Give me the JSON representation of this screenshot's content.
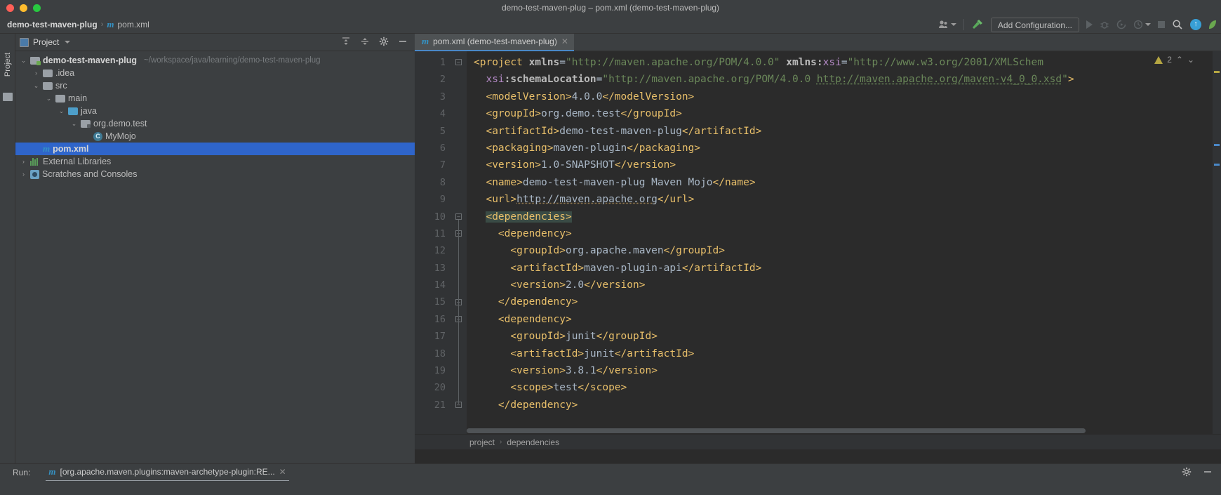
{
  "window": {
    "title": "demo-test-maven-plug – pom.xml (demo-test-maven-plug)"
  },
  "navbar": {
    "crumb_project": "demo-test-maven-plug",
    "crumb_sep": "›",
    "crumb_file": "pom.xml",
    "file_icon": "m",
    "add_configuration": "Add Configuration...",
    "icons": [
      "user-avatar-icon",
      "chevron-down-icon",
      "build-hammer-icon",
      "run-icon",
      "debug-icon",
      "run-with-coverage-icon",
      "profile-icon",
      "chevron-down-icon",
      "stop-icon",
      "search-icon",
      "update-icon"
    ]
  },
  "left_strip": {
    "tab_label": "Project"
  },
  "project_panel": {
    "title": "Project",
    "header_icons": [
      "collapse-all-icon",
      "expand-all-icon",
      "settings-gear-icon",
      "hide-panel-icon"
    ],
    "tree": [
      {
        "label": "demo-test-maven-plug",
        "path": "~/workspace/java/learning/demo-test-maven-plug",
        "indent": 0,
        "arrow": "v",
        "icon": "module-folder-icon",
        "bold": true,
        "selected": false
      },
      {
        "label": ".idea",
        "path": "",
        "indent": 1,
        "arrow": ">",
        "icon": "folder-icon",
        "bold": false,
        "selected": false
      },
      {
        "label": "src",
        "path": "",
        "indent": 1,
        "arrow": "v",
        "icon": "folder-icon",
        "bold": false,
        "selected": false
      },
      {
        "label": "main",
        "path": "",
        "indent": 2,
        "arrow": "v",
        "icon": "folder-icon",
        "bold": false,
        "selected": false
      },
      {
        "label": "java",
        "path": "",
        "indent": 3,
        "arrow": "v",
        "icon": "source-folder-icon",
        "bold": false,
        "selected": false
      },
      {
        "label": "org.demo.test",
        "path": "",
        "indent": 4,
        "arrow": "v",
        "icon": "package-icon",
        "bold": false,
        "selected": false
      },
      {
        "label": "MyMojo",
        "path": "",
        "indent": 5,
        "arrow": "",
        "icon": "java-class-icon",
        "bold": false,
        "selected": false
      },
      {
        "label": "pom.xml",
        "path": "",
        "indent": 1,
        "arrow": "",
        "icon": "maven-file-icon",
        "bold": true,
        "selected": true
      },
      {
        "label": "External Libraries",
        "path": "",
        "indent": 0,
        "arrow": ">",
        "icon": "libraries-icon",
        "bold": false,
        "selected": false
      },
      {
        "label": "Scratches and Consoles",
        "path": "",
        "indent": 0,
        "arrow": ">",
        "icon": "scratches-icon",
        "bold": false,
        "selected": false
      }
    ]
  },
  "editor": {
    "tab_label": "pom.xml (demo-test-maven-plug)",
    "tab_icon": "m",
    "tab_close": "✕",
    "warning_count": "2",
    "warning_icon": "warning-triangle-icon",
    "nav_up": "⌃",
    "nav_down": "⌄",
    "breadcrumb": [
      "project",
      "dependencies"
    ],
    "breadcrumb_sep": "›",
    "line_numbers": [
      1,
      2,
      3,
      4,
      5,
      6,
      7,
      8,
      9,
      10,
      11,
      12,
      13,
      14,
      15,
      16,
      17,
      18,
      19,
      20,
      21
    ],
    "lines": [
      {
        "n": 1,
        "fold": "collapse",
        "html": "<span class=\"tag\">&lt;project </span><span class=\"attr\">xmlns</span><span class=\"txt\">=</span><span class=\"str\">\"http://maven.apache.org/POM/4.0.0\"</span><span class=\"txt\"> </span><span class=\"attr\">xmlns:</span><span class=\"ns\">xsi</span><span class=\"txt\">=</span><span class=\"str\">\"http://www.w3.org/2001/XMLSchem</span>"
      },
      {
        "n": 2,
        "fold": "",
        "html": "  <span class=\"ns\">xsi</span><span class=\"attr\">:schemaLocation</span><span class=\"txt\">=</span><span class=\"str\">\"http://maven.apache.org/POM/4.0.0 </span><span class=\"link\">http://maven.apache.org/maven-v4_0_0.xsd</span><span class=\"str\">\"</span><span class=\"tag\">&gt;</span>"
      },
      {
        "n": 3,
        "fold": "",
        "html": "  <span class=\"tag\">&lt;modelVersion&gt;</span><span class=\"txt\">4.0.0</span><span class=\"tag\">&lt;/modelVersion&gt;</span>"
      },
      {
        "n": 4,
        "fold": "",
        "html": "  <span class=\"tag\">&lt;groupId&gt;</span><span class=\"txt\">org.demo.test</span><span class=\"tag\">&lt;/groupId&gt;</span>"
      },
      {
        "n": 5,
        "fold": "",
        "html": "  <span class=\"tag\">&lt;artifactId&gt;</span><span class=\"txt\">demo-test-maven-plug</span><span class=\"tag\">&lt;/artifactId&gt;</span>"
      },
      {
        "n": 6,
        "fold": "",
        "html": "  <span class=\"tag\">&lt;packaging&gt;</span><span class=\"txt\">maven-plugin</span><span class=\"tag\">&lt;/packaging&gt;</span>"
      },
      {
        "n": 7,
        "fold": "",
        "html": "  <span class=\"tag\">&lt;version&gt;</span><span class=\"txt\">1.0-SNAPSHOT</span><span class=\"tag\">&lt;/version&gt;</span>"
      },
      {
        "n": 8,
        "fold": "",
        "html": "  <span class=\"tag\">&lt;name&gt;</span><span class=\"txt\">demo-test-maven-plug Maven Mojo</span><span class=\"tag\">&lt;/name&gt;</span>"
      },
      {
        "n": 9,
        "fold": "",
        "html": "  <span class=\"tag\">&lt;url&gt;</span><span class=\"urltxt\">http://maven.apache.org</span><span class=\"tag\">&lt;/url&gt;</span>"
      },
      {
        "n": 10,
        "fold": "collapse",
        "html": "  <span class=\"tag hl\">&lt;dependencies&gt;</span>"
      },
      {
        "n": 11,
        "fold": "collapse",
        "html": "    <span class=\"tag\">&lt;dependency&gt;</span>"
      },
      {
        "n": 12,
        "fold": "",
        "html": "      <span class=\"tag\">&lt;groupId&gt;</span><span class=\"txt\">org.apache.maven</span><span class=\"tag\">&lt;/groupId&gt;</span>"
      },
      {
        "n": 13,
        "fold": "",
        "html": "      <span class=\"tag\">&lt;artifactId&gt;</span><span class=\"txt\">maven-plugin-api</span><span class=\"tag\">&lt;/artifactId&gt;</span>"
      },
      {
        "n": 14,
        "fold": "",
        "html": "      <span class=\"tag\">&lt;version&gt;</span><span class=\"txt\">2.0</span><span class=\"tag\">&lt;/version&gt;</span>"
      },
      {
        "n": 15,
        "fold": "expand",
        "html": "    <span class=\"tag\">&lt;/dependency&gt;</span>"
      },
      {
        "n": 16,
        "fold": "collapse",
        "html": "    <span class=\"tag\">&lt;dependency&gt;</span>"
      },
      {
        "n": 17,
        "fold": "",
        "html": "      <span class=\"tag\">&lt;groupId&gt;</span><span class=\"txt\">junit</span><span class=\"tag\">&lt;/groupId&gt;</span>"
      },
      {
        "n": 18,
        "fold": "",
        "html": "      <span class=\"tag\">&lt;artifactId&gt;</span><span class=\"txt\">junit</span><span class=\"tag\">&lt;/artifactId&gt;</span>"
      },
      {
        "n": 19,
        "fold": "",
        "html": "      <span class=\"tag\">&lt;version&gt;</span><span class=\"txt\">3.8.1</span><span class=\"tag\">&lt;/version&gt;</span>"
      },
      {
        "n": 20,
        "fold": "",
        "html": "      <span class=\"tag\">&lt;scope&gt;</span><span class=\"txt\">test</span><span class=\"tag\">&lt;/scope&gt;</span>"
      },
      {
        "n": 21,
        "fold": "expand",
        "html": "    <span class=\"tag\">&lt;/dependency&gt;</span>"
      }
    ]
  },
  "run_panel": {
    "label": "Run:",
    "tab_icon": "m",
    "tab_label": "[org.apache.maven.plugins:maven-archetype-plugin:RE...",
    "tab_close": "✕",
    "right_icons": [
      "settings-gear-icon",
      "hide-panel-icon"
    ]
  },
  "colors": {
    "accent_blue": "#2f65ca",
    "tab_underline": "#4a88c7",
    "tag": "#e8bf6a",
    "string": "#6a8759",
    "editor_bg": "#2b2b2b",
    "panel_bg": "#3c3f41"
  }
}
